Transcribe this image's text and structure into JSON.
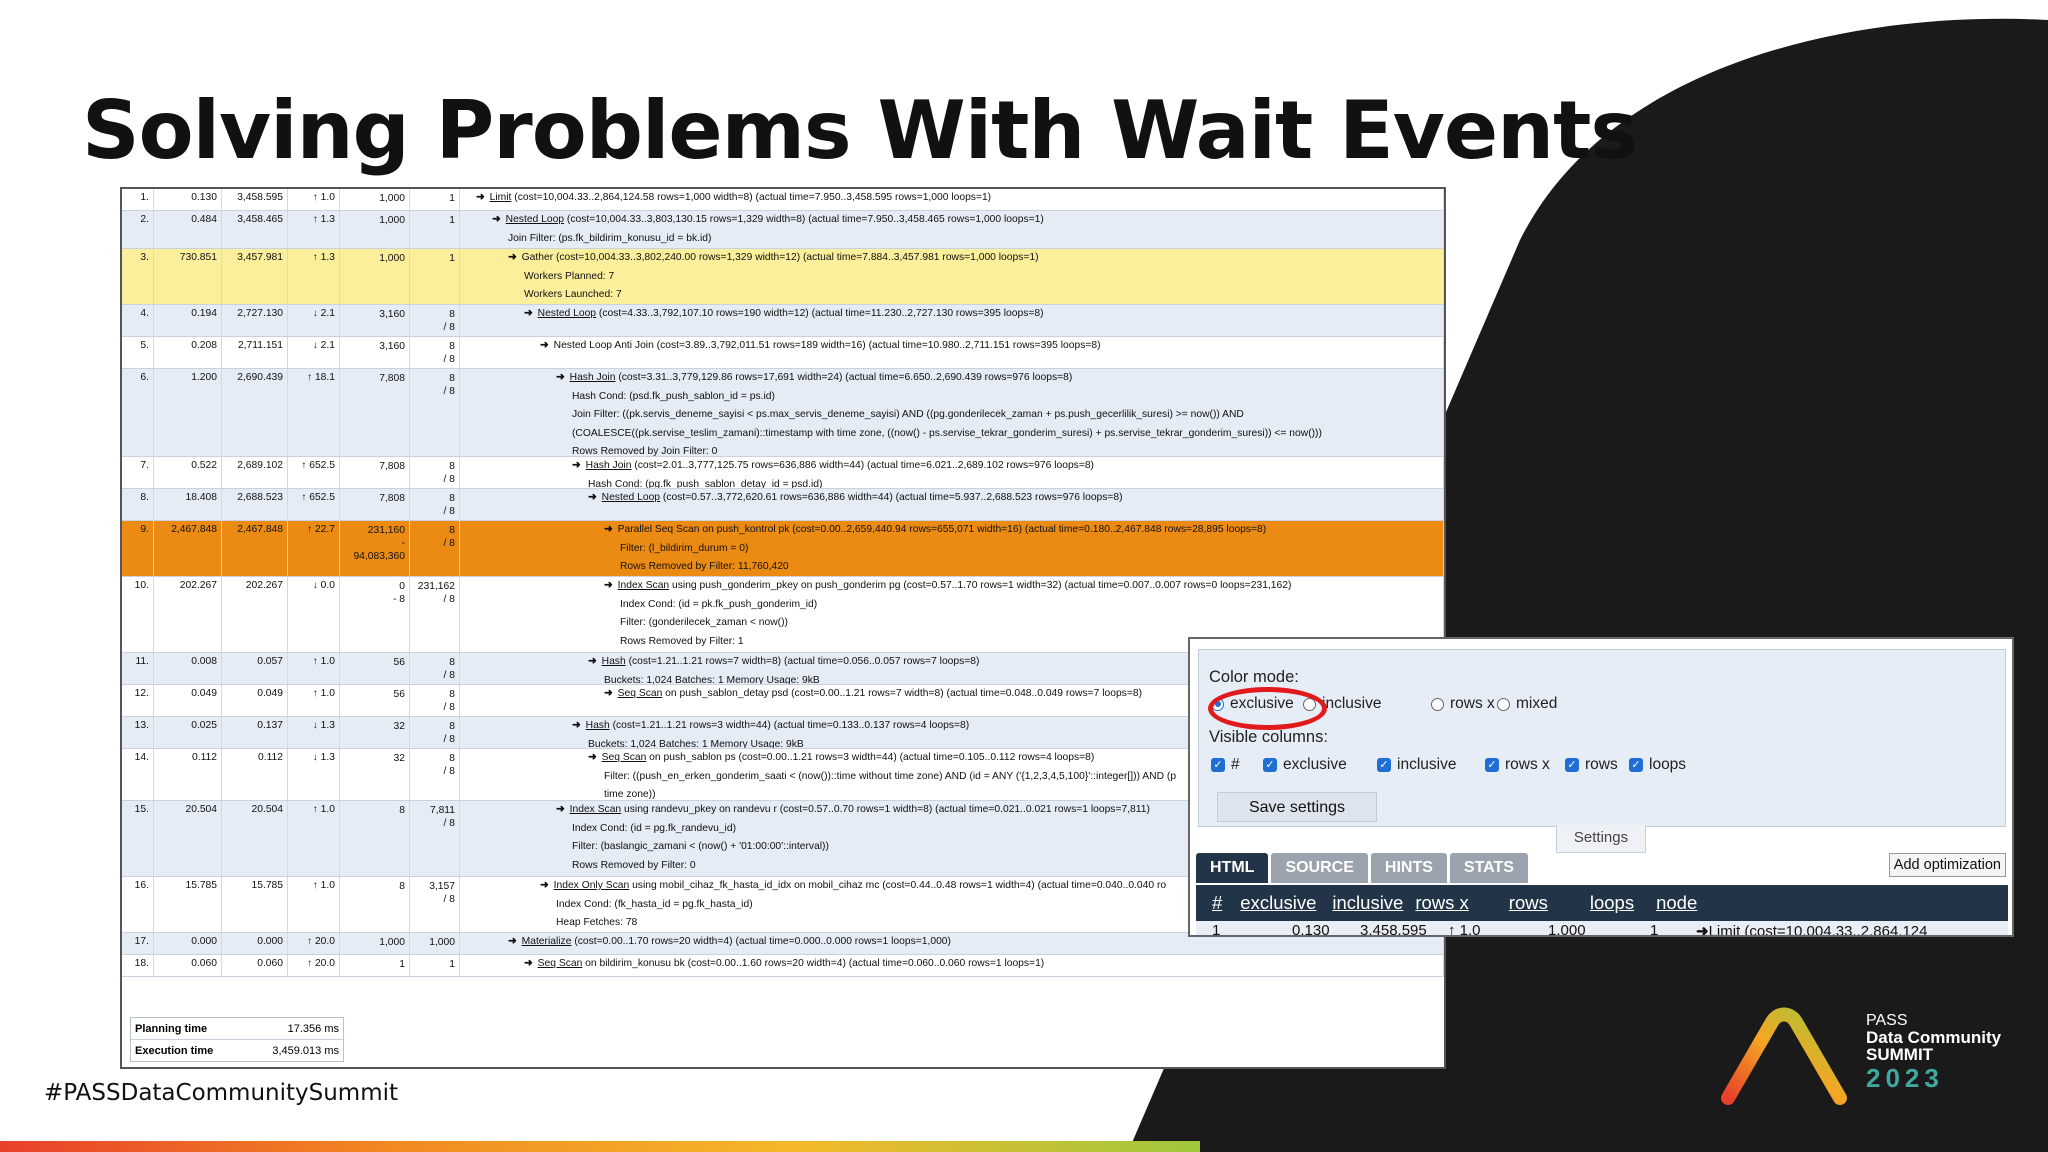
{
  "slide": {
    "title": "Solving Problems With Wait Events",
    "hashtag": "#PASSDataCommunitySummit"
  },
  "logo": {
    "line1": "PASS",
    "line2": "Data Community",
    "line3": "SUMMIT",
    "year": "2023"
  },
  "plan_rows": [
    {
      "num": "1.",
      "exclusive": "0.130",
      "inclusive": "3,458.595",
      "rows_x": "↑ 1.0",
      "rows": [
        "1,000"
      ],
      "loops": [
        "1"
      ],
      "bg": "white",
      "indent": 0,
      "op": "Limit",
      "rest": "(cost=10,004.33..2,864,124.58 rows=1,000 width=8) (actual time=7.950..3,458.595 rows=1,000 loops=1)",
      "details": []
    },
    {
      "num": "2.",
      "exclusive": "0.484",
      "inclusive": "3,458.465",
      "rows_x": "↑ 1.3",
      "rows": [
        "1,000"
      ],
      "loops": [
        "1"
      ],
      "bg": "blue",
      "indent": 1,
      "op": "Nested Loop",
      "rest": "(cost=10,004.33..3,803,130.15 rows=1,329 width=8) (actual time=7.950..3,458.465 rows=1,000 loops=1)",
      "details": [
        "Join Filter: (ps.fk_bildirim_konusu_id = bk.id)"
      ]
    },
    {
      "num": "3.",
      "exclusive": "730.851",
      "inclusive": "3,457.981",
      "rows_x": "↑ 1.3",
      "rows": [
        "1,000"
      ],
      "loops": [
        "1"
      ],
      "bg": "yellow",
      "indent": 2,
      "op": "",
      "rest": "Gather (cost=10,004.33..3,802,240.00 rows=1,329 width=12) (actual time=7.884..3,457.981 rows=1,000 loops=1)",
      "details": [
        "Workers Planned: 7",
        "Workers Launched: 7"
      ]
    },
    {
      "num": "4.",
      "exclusive": "0.194",
      "inclusive": "2,727.130",
      "rows_x": "↓ 2.1",
      "rows": [
        "3,160"
      ],
      "loops": [
        "8",
        "/ 8"
      ],
      "bg": "blue",
      "indent": 3,
      "op": "Nested Loop",
      "rest": "(cost=4.33..3,792,107.10 rows=190 width=12) (actual time=11.230..2,727.130 rows=395 loops=8)",
      "details": []
    },
    {
      "num": "5.",
      "exclusive": "0.208",
      "inclusive": "2,711.151",
      "rows_x": "↓ 2.1",
      "rows": [
        "3,160"
      ],
      "loops": [
        "8",
        "/ 8"
      ],
      "bg": "white",
      "indent": 4,
      "op": "",
      "rest": "Nested Loop Anti Join (cost=3.89..3,792,011.51 rows=189 width=16) (actual time=10.980..2,711.151 rows=395 loops=8)",
      "details": []
    },
    {
      "num": "6.",
      "exclusive": "1.200",
      "inclusive": "2,690.439",
      "rows_x": "↑ 18.1",
      "rows": [
        "7,808"
      ],
      "loops": [
        "8",
        "/ 8"
      ],
      "bg": "blue",
      "indent": 5,
      "op": "Hash Join",
      "rest": "(cost=3.31..3,779,129.86 rows=17,691 width=24) (actual time=6.650..2,690.439 rows=976 loops=8)",
      "details": [
        "Hash Cond: (psd.fk_push_sablon_id = ps.id)",
        "Join Filter: ((pk.servis_deneme_sayisi < ps.max_servis_deneme_sayisi) AND ((pg.gonderilecek_zaman + ps.push_gecerlilik_suresi) >= now()) AND",
        "(COALESCE((pk.servise_teslim_zamani)::timestamp with time zone, ((now() - ps.servise_tekrar_gonderim_suresi) + ps.servise_tekrar_gonderim_suresi)) <= now()))",
        "Rows Removed by Join Filter: 0"
      ]
    },
    {
      "num": "7.",
      "exclusive": "0.522",
      "inclusive": "2,689.102",
      "rows_x": "↑ 652.5",
      "rows": [
        "7,808"
      ],
      "loops": [
        "8",
        "/ 8"
      ],
      "bg": "white",
      "indent": 6,
      "op": "Hash Join",
      "rest": "(cost=2.01..3,777,125.75 rows=636,886 width=44) (actual time=6.021..2,689.102 rows=976 loops=8)",
      "details": [
        "Hash Cond: (pg.fk_push_sablon_detay_id = psd.id)"
      ]
    },
    {
      "num": "8.",
      "exclusive": "18.408",
      "inclusive": "2,688.523",
      "rows_x": "↑ 652.5",
      "rows": [
        "7,808"
      ],
      "loops": [
        "8",
        "/ 8"
      ],
      "bg": "blue",
      "indent": 7,
      "op": "Nested Loop",
      "rest": "(cost=0.57..3,772,620.61 rows=636,886 width=44) (actual time=5.937..2,688.523 rows=976 loops=8)",
      "details": []
    },
    {
      "num": "9.",
      "exclusive": "2,467.848",
      "inclusive": "2,467.848",
      "rows_x": "↑ 22.7",
      "rows": [
        "231,160",
        "-",
        "94,083,360"
      ],
      "loops": [
        "8",
        "/ 8"
      ],
      "bg": "orange",
      "indent": 8,
      "op": "",
      "rest": "Parallel Seq Scan on push_kontrol pk (cost=0.00..2,659,440.94 rows=655,071 width=16) (actual time=0.180..2,467.848 rows=28,895 loops=8)",
      "details": [
        "Filter: (l_bildirim_durum = 0)",
        "Rows Removed by Filter: 11,760,420"
      ]
    },
    {
      "num": "10.",
      "exclusive": "202.267",
      "inclusive": "202.267",
      "rows_x": "↓ 0.0",
      "rows": [
        "0",
        "- 8"
      ],
      "loops": [
        "231,162",
        "/ 8"
      ],
      "bg": "white",
      "indent": 8,
      "op": "Index Scan",
      "rest": "using push_gonderim_pkey on push_gonderim pg (cost=0.57..1.70 rows=1 width=32) (actual time=0.007..0.007 rows=0 loops=231,162)",
      "details": [
        "Index Cond: (id = pk.fk_push_gonderim_id)",
        "Filter: (gonderilecek_zaman < now())",
        "Rows Removed by Filter: 1"
      ]
    },
    {
      "num": "11.",
      "exclusive": "0.008",
      "inclusive": "0.057",
      "rows_x": "↑ 1.0",
      "rows": [
        "56"
      ],
      "loops": [
        "8",
        "/ 8"
      ],
      "bg": "blue",
      "indent": 7,
      "op": "Hash",
      "rest": "(cost=1.21..1.21 rows=7 width=8) (actual time=0.056..0.057 rows=7 loops=8)",
      "details": [
        "Buckets: 1,024 Batches: 1 Memory Usage: 9kB"
      ]
    },
    {
      "num": "12.",
      "exclusive": "0.049",
      "inclusive": "0.049",
      "rows_x": "↑ 1.0",
      "rows": [
        "56"
      ],
      "loops": [
        "8",
        "/ 8"
      ],
      "bg": "white",
      "indent": 8,
      "op": "Seq Scan",
      "rest": "on push_sablon_detay psd (cost=0.00..1.21 rows=7 width=8) (actual time=0.048..0.049 rows=7 loops=8)",
      "details": []
    },
    {
      "num": "13.",
      "exclusive": "0.025",
      "inclusive": "0.137",
      "rows_x": "↓ 1.3",
      "rows": [
        "32"
      ],
      "loops": [
        "8",
        "/ 8"
      ],
      "bg": "blue",
      "indent": 6,
      "op": "Hash",
      "rest": "(cost=1.21..1.21 rows=3 width=44) (actual time=0.133..0.137 rows=4 loops=8)",
      "details": [
        "Buckets: 1,024 Batches: 1 Memory Usage: 9kB"
      ]
    },
    {
      "num": "14.",
      "exclusive": "0.112",
      "inclusive": "0.112",
      "rows_x": "↓ 1.3",
      "rows": [
        "32"
      ],
      "loops": [
        "8",
        "/ 8"
      ],
      "bg": "white",
      "indent": 7,
      "op": "Seq Scan",
      "rest": "on push_sablon ps (cost=0.00..1.21 rows=3 width=44) (actual time=0.105..0.112 rows=4 loops=8)",
      "details": [
        "Filter: ((push_en_erken_gonderim_saati < (now())::time without time zone) AND (id = ANY ('{1,2,3,4,5,100}'::integer[])) AND (p",
        "time zone))"
      ]
    },
    {
      "num": "15.",
      "exclusive": "20.504",
      "inclusive": "20.504",
      "rows_x": "↑ 1.0",
      "rows": [
        "8"
      ],
      "loops": [
        "7,811",
        "/ 8"
      ],
      "bg": "blue",
      "indent": 5,
      "op": "Index Scan",
      "rest": "using randevu_pkey on randevu r (cost=0.57..0.70 rows=1 width=8) (actual time=0.021..0.021 rows=1 loops=7,811)",
      "details": [
        "Index Cond: (id = pg.fk_randevu_id)",
        "Filter: (baslangic_zamani < (now() + '01:00:00'::interval))",
        "Rows Removed by Filter: 0"
      ]
    },
    {
      "num": "16.",
      "exclusive": "15.785",
      "inclusive": "15.785",
      "rows_x": "↑ 1.0",
      "rows": [
        "8"
      ],
      "loops": [
        "3,157",
        "/ 8"
      ],
      "bg": "white",
      "indent": 4,
      "op": "Index Only Scan",
      "rest": "using mobil_cihaz_fk_hasta_id_idx on mobil_cihaz mc (cost=0.44..0.48 rows=1 width=4) (actual time=0.040..0.040 ro",
      "details": [
        "Index Cond: (fk_hasta_id = pg.fk_hasta_id)",
        "Heap Fetches: 78"
      ]
    },
    {
      "num": "17.",
      "exclusive": "0.000",
      "inclusive": "0.000",
      "rows_x": "↑ 20.0",
      "rows": [
        "1,000"
      ],
      "loops": [
        "1,000"
      ],
      "bg": "blue",
      "indent": 2,
      "op": "Materialize",
      "rest": "(cost=0.00..1.70 rows=20 width=4) (actual time=0.000..0.000 rows=1 loops=1,000)",
      "details": []
    },
    {
      "num": "18.",
      "exclusive": "0.060",
      "inclusive": "0.060",
      "rows_x": "↑ 20.0",
      "rows": [
        "1"
      ],
      "loops": [
        "1"
      ],
      "bg": "white",
      "indent": 3,
      "op": "Seq Scan",
      "rest": "on bildirim_konusu bk (cost=0.00..1.60 rows=20 width=4) (actual time=0.060..0.060 rows=1 loops=1)",
      "details": []
    }
  ],
  "summary": {
    "planning_label": "Planning time",
    "planning_value": "17.356 ms",
    "execution_label": "Execution time",
    "execution_value": "3,459.013 ms"
  },
  "settings": {
    "color_mode_label": "Color mode:",
    "color_modes": [
      "exclusive",
      "inclusive",
      "rows x",
      "mixed"
    ],
    "selected_color_mode": "exclusive",
    "visible_columns_label": "Visible columns:",
    "columns": [
      "#",
      "exclusive",
      "inclusive",
      "rows x",
      "rows",
      "loops"
    ],
    "save_label": "Save settings",
    "settings_tab": "Settings",
    "highlight_color": "#e11b1b"
  },
  "tabs": [
    "HTML",
    "SOURCE",
    "HINTS",
    "STATS"
  ],
  "active_tab": "HTML",
  "add_optimization": "Add optimization",
  "table_header": [
    "#",
    "exclusive",
    "inclusive",
    "rows x",
    "rows",
    "loops",
    "node"
  ],
  "first_row_partial": {
    "num": "1",
    "exclusive": "0.130",
    "inclusive": "3,458.595",
    "rows_x": "↑ 1.0",
    "rows": "1,000",
    "loops": "1",
    "node": "Limit  (cost=10,004.33..2,864,124"
  },
  "colors": {
    "row_blue": "#e5ecf6",
    "row_yellow": "#fbef9b",
    "row_orange": "#ec8b14",
    "header_dark": "#223548",
    "slide_dark": "#1a1a1a"
  }
}
